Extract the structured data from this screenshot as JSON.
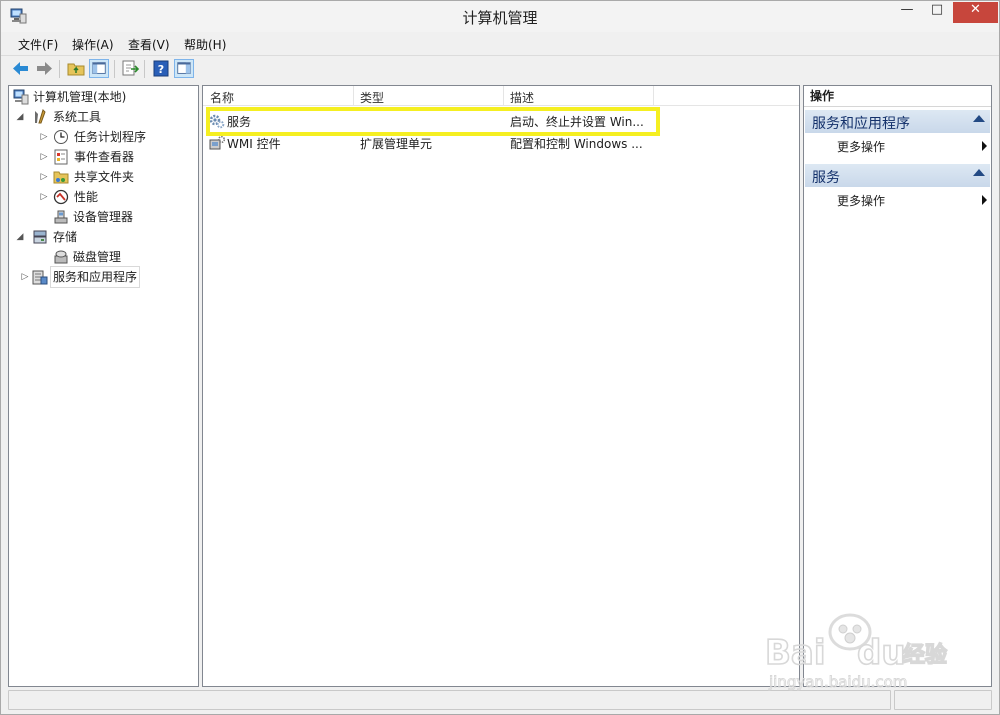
{
  "window": {
    "title": "计算机管理",
    "min_glyph": "—",
    "max_glyph": "□",
    "close_glyph": "✕"
  },
  "menu": [
    {
      "label": "文件(F)"
    },
    {
      "label": "操作(A)"
    },
    {
      "label": "查看(V)"
    },
    {
      "label": "帮助(H)"
    }
  ],
  "toolbar": {
    "icons": [
      "back-arrow-icon",
      "forward-arrow-icon",
      "up-folder-icon",
      "show-hide-console-tree-icon",
      "export-list-icon",
      "help-icon",
      "show-hide-action-pane-icon"
    ]
  },
  "tree": {
    "root": "计算机管理(本地)",
    "system_tools": "系统工具",
    "task_scheduler": "任务计划程序",
    "event_viewer": "事件查看器",
    "shared_folders": "共享文件夹",
    "performance": "性能",
    "device_manager": "设备管理器",
    "storage": "存储",
    "disk_management": "磁盘管理",
    "services_apps": "服务和应用程序"
  },
  "list": {
    "columns": [
      "名称",
      "类型",
      "描述"
    ],
    "rows": [
      {
        "name": "服务",
        "type": "",
        "description": "启动、终止并设置 Win..."
      },
      {
        "name": "WMI 控件",
        "type": "扩展管理单元",
        "description": "配置和控制 Windows ..."
      }
    ]
  },
  "actions": {
    "title": "操作",
    "sections": [
      {
        "label": "服务和应用程序",
        "item": "更多操作"
      },
      {
        "label": "服务",
        "item": "更多操作"
      }
    ]
  },
  "watermark": {
    "brand": "Bai",
    "brand2": "du",
    "product": "经验",
    "url": "jingyan.baidu.com"
  },
  "colors": {
    "highlight": "#f5ef21",
    "close_button": "#c7463c",
    "section_header": "#c9d8ea",
    "section_text": "#14316b"
  }
}
